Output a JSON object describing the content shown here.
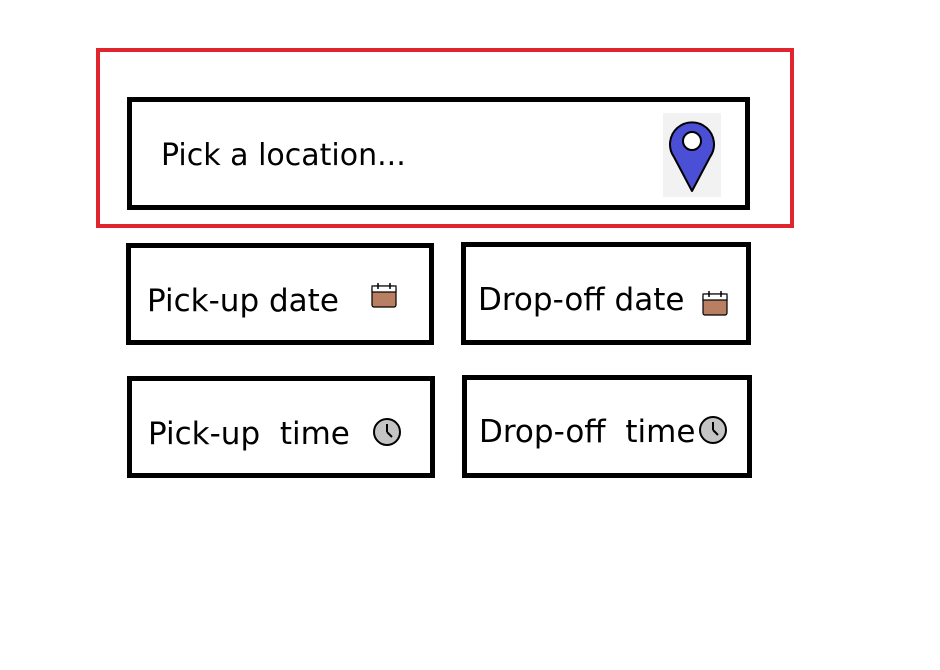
{
  "location": {
    "placeholder": "Pick a location...",
    "icon": "map-pin-icon",
    "icon_color": "#4a4fd6"
  },
  "pickup_date": {
    "label": "Pick-up date",
    "icon": "calendar-icon"
  },
  "dropoff_date": {
    "label": "Drop-off date",
    "icon": "calendar-icon"
  },
  "pickup_time": {
    "label": "Pick-up  time",
    "icon": "clock-icon"
  },
  "dropoff_time": {
    "label": "Drop-off  time",
    "icon": "clock-icon"
  },
  "colors": {
    "highlight_border": "#e0252e",
    "field_border": "#000000",
    "calendar_fill": "#b97f63",
    "clock_fill": "#c4c4c4"
  }
}
